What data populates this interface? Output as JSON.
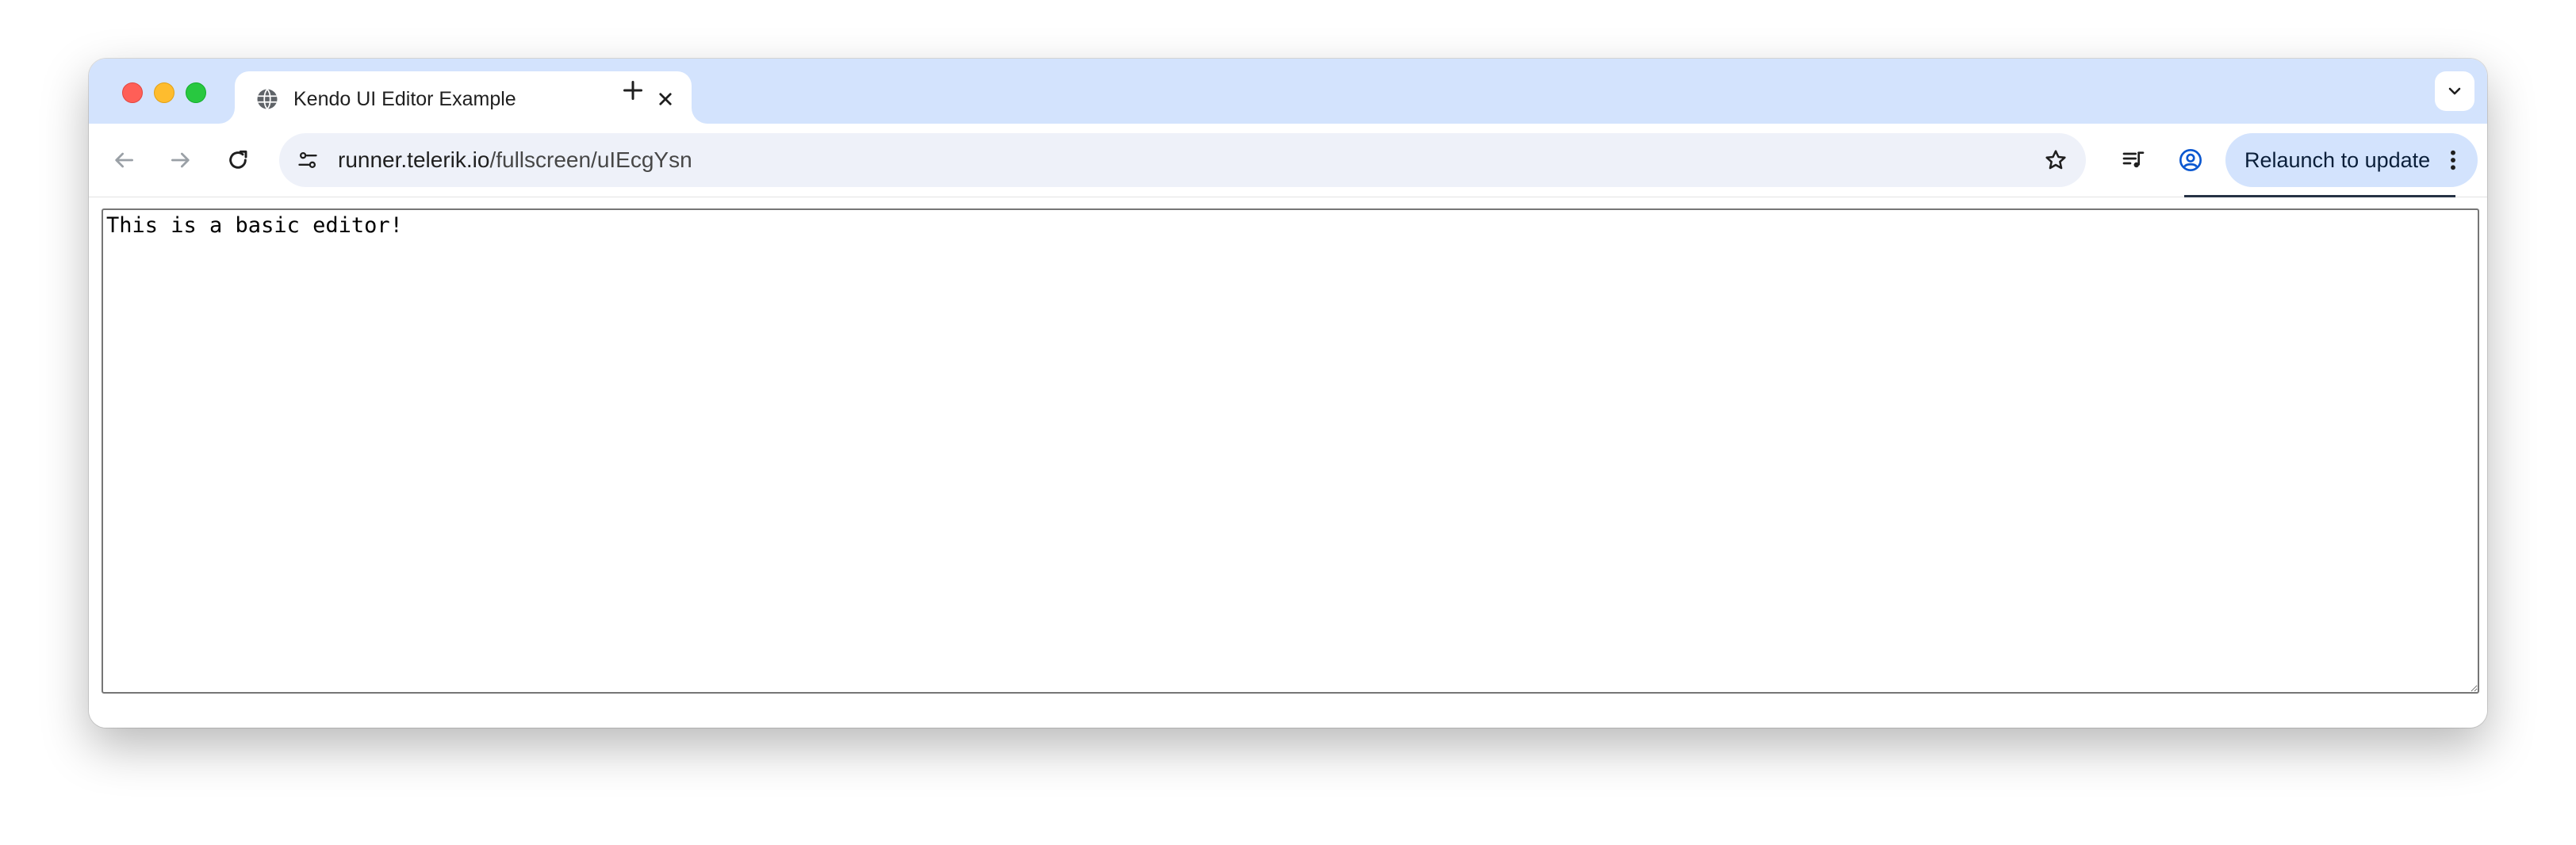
{
  "browser": {
    "tab": {
      "title": "Kendo UI Editor Example",
      "favicon": "globe-icon"
    },
    "address_bar": {
      "host": "runner.telerik.io",
      "path": "/fullscreen/uIEcgYsn"
    },
    "relaunch_button": {
      "label": "Relaunch to update"
    },
    "colors": {
      "tab_strip": "#d3e3fd",
      "omnibox": "#eef1f9",
      "relaunch_bg": "#d3e3fd",
      "close": "#ff5f57",
      "minimize": "#febc2e",
      "maximize": "#28c840"
    }
  },
  "page": {
    "editor": {
      "value": "This is a basic editor!"
    }
  }
}
